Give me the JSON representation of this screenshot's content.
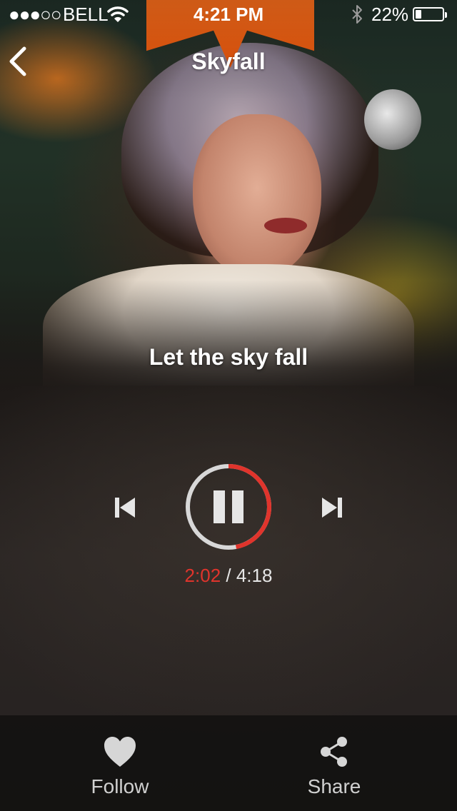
{
  "status_bar": {
    "signal": "●●●○○",
    "carrier": "BELL",
    "time": "4:21 PM",
    "battery_percent": "22%",
    "battery_level": 0.22
  },
  "nav": {
    "title": "Skyfall"
  },
  "lyric": "Let the sky fall",
  "player": {
    "elapsed": "2:02",
    "separator": " / ",
    "duration": "4:18",
    "progress": 0.47,
    "accent_color": "#e0342c"
  },
  "tabbar": {
    "follow_label": "Follow",
    "share_label": "Share"
  }
}
